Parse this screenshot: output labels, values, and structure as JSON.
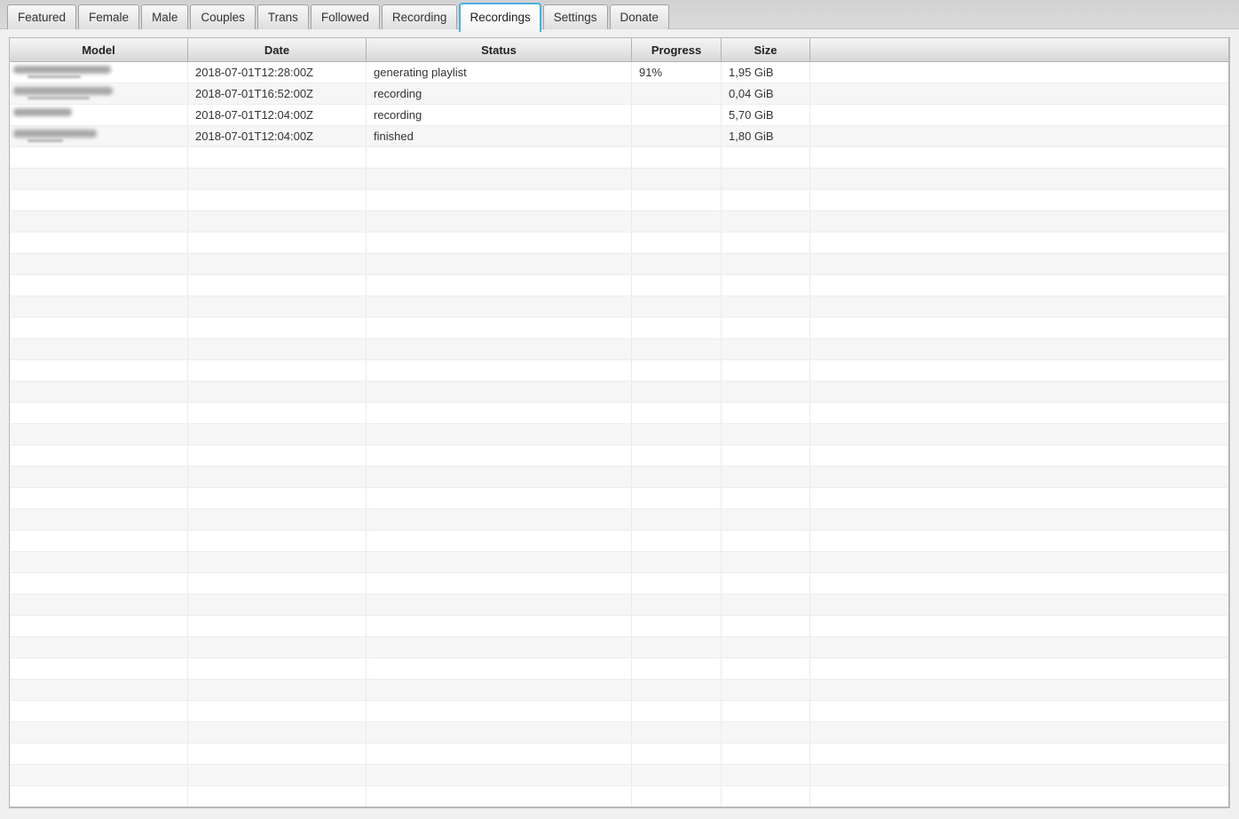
{
  "colors": {
    "active_tab_border": "#48b0e0",
    "header_text": "#222222",
    "body_text": "#333333",
    "row_stripe": "#f6f6f6"
  },
  "tabs": [
    {
      "label": "Featured",
      "active": false
    },
    {
      "label": "Female",
      "active": false
    },
    {
      "label": "Male",
      "active": false
    },
    {
      "label": "Couples",
      "active": false
    },
    {
      "label": "Trans",
      "active": false
    },
    {
      "label": "Followed",
      "active": false
    },
    {
      "label": "Recording",
      "active": false
    },
    {
      "label": "Recordings",
      "active": true
    },
    {
      "label": "Settings",
      "active": false
    },
    {
      "label": "Donate",
      "active": false
    }
  ],
  "table": {
    "columns": [
      {
        "key": "model",
        "label": "Model"
      },
      {
        "key": "date",
        "label": "Date"
      },
      {
        "key": "status",
        "label": "Status"
      },
      {
        "key": "progress",
        "label": "Progress"
      },
      {
        "key": "size",
        "label": "Size"
      },
      {
        "key": "extra",
        "label": ""
      }
    ],
    "rows": [
      {
        "model_redacted": true,
        "model_blur_width": 110,
        "model_blur_sub_width": 60,
        "date": "2018-07-01T12:28:00Z",
        "status": "generating playlist",
        "progress": "91%",
        "size": "1,95 GiB"
      },
      {
        "model_redacted": true,
        "model_blur_width": 112,
        "model_blur_sub_width": 70,
        "date": "2018-07-01T16:52:00Z",
        "status": "recording",
        "progress": "",
        "size": "0,04 GiB"
      },
      {
        "model_redacted": true,
        "model_blur_width": 66,
        "model_blur_sub_width": 0,
        "date": "2018-07-01T12:04:00Z",
        "status": "recording",
        "progress": "",
        "size": "5,70 GiB"
      },
      {
        "model_redacted": true,
        "model_blur_width": 94,
        "model_blur_sub_width": 40,
        "date": "2018-07-01T12:04:00Z",
        "status": "finished",
        "progress": "",
        "size": "1,80 GiB"
      }
    ],
    "empty_row_count": 31
  }
}
